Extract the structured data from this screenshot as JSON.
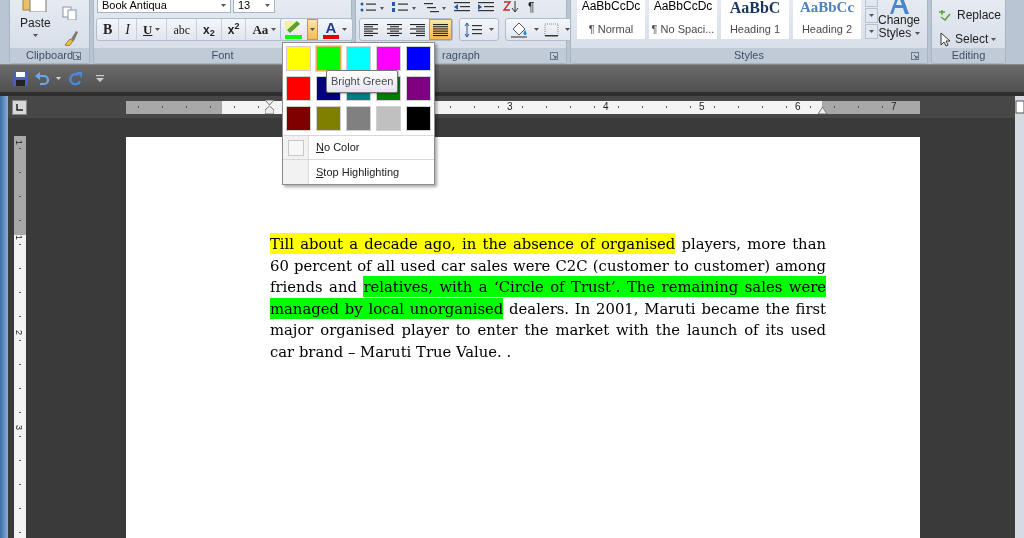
{
  "ribbon": {
    "clipboard": {
      "paste": "Paste",
      "label": "Clipboard"
    },
    "font": {
      "name": "Book Antiqua",
      "size": "13",
      "label": "Font",
      "format_buttons": [
        {
          "kind": "bold",
          "text": "B"
        },
        {
          "kind": "italic",
          "text": "I"
        },
        {
          "kind": "underline",
          "text": "U"
        },
        {
          "kind": "strike",
          "text": "abc"
        },
        {
          "kind": "plain",
          "text": "x$_{2}$"
        },
        {
          "kind": "plain",
          "text": "x$^{2}$"
        },
        {
          "kind": "case",
          "text": "Aa"
        }
      ],
      "highlight_open": true,
      "font_color_text": "A"
    },
    "paragraph": {
      "label": "ragraph",
      "pilcrow": "¶",
      "align_buttons": [
        {
          "kind": "left",
          "selected": false
        },
        {
          "kind": "center",
          "selected": false
        },
        {
          "kind": "right",
          "selected": false
        },
        {
          "kind": "justify",
          "selected": true
        }
      ]
    },
    "styles": {
      "label": "Styles",
      "change_styles": "Change Styles",
      "items": [
        {
          "kind": "body",
          "preview": "AaBbCcDc",
          "name": "¶ Normal"
        },
        {
          "kind": "body",
          "preview": "AaBbCcDc",
          "name": "¶ No Spaci..."
        },
        {
          "kind": "heading1",
          "preview": "AaBbC",
          "name": "Heading 1"
        },
        {
          "kind": "heading2",
          "preview": "AaBbCc",
          "name": "Heading 2"
        }
      ]
    },
    "editing": {
      "label": "Editing",
      "replace": "Replace",
      "select": "Select"
    }
  },
  "horizontal_ruler": {
    "labels": [
      "3",
      "4",
      "5",
      "6",
      "7"
    ]
  },
  "vertical_ruler": {
    "labels": [
      "1",
      "1",
      "2",
      "3"
    ]
  },
  "document": {
    "runs": [
      {
        "text": "Till about a decade ago, in the absence of organised",
        "color": "#ffff00"
      },
      {
        "text": " players, more than 60 percent of all used car sales were C2C (customer to customer) among friends and "
      },
      {
        "text": "relatives, with a ‘Circle of Trust’. The remaining sales were managed by local unorganised",
        "color": "#00ff00"
      },
      {
        "text": " dealers. In 2001, Maruti became the first major organised player to enter the market with the launch of its used car brand – Maruti True Value. ."
      }
    ]
  },
  "highlight_menu": {
    "swatches": [
      {
        "color": "#ffff00",
        "selected": false
      },
      {
        "color": "#00ff00",
        "selected": true
      },
      {
        "color": "#00ffff",
        "selected": false
      },
      {
        "color": "#ff00ff",
        "selected": false
      },
      {
        "color": "#0000ff",
        "selected": false
      },
      {
        "color": "#ff0000",
        "selected": false
      },
      {
        "color": "#000080",
        "selected": false
      },
      {
        "color": "#008080",
        "selected": false
      },
      {
        "color": "#008000",
        "selected": false
      },
      {
        "color": "#800080",
        "selected": false
      },
      {
        "color": "#800000",
        "selected": false
      },
      {
        "color": "#808000",
        "selected": false
      },
      {
        "color": "#808080",
        "selected": false
      },
      {
        "color": "#c0c0c0",
        "selected": false
      },
      {
        "color": "#000000",
        "selected": false
      }
    ],
    "tooltip": "Bright Green",
    "items": [
      {
        "kind": "no_color",
        "label": "No Color"
      },
      {
        "kind": "stop",
        "label": "Stop Highlighting"
      }
    ]
  }
}
